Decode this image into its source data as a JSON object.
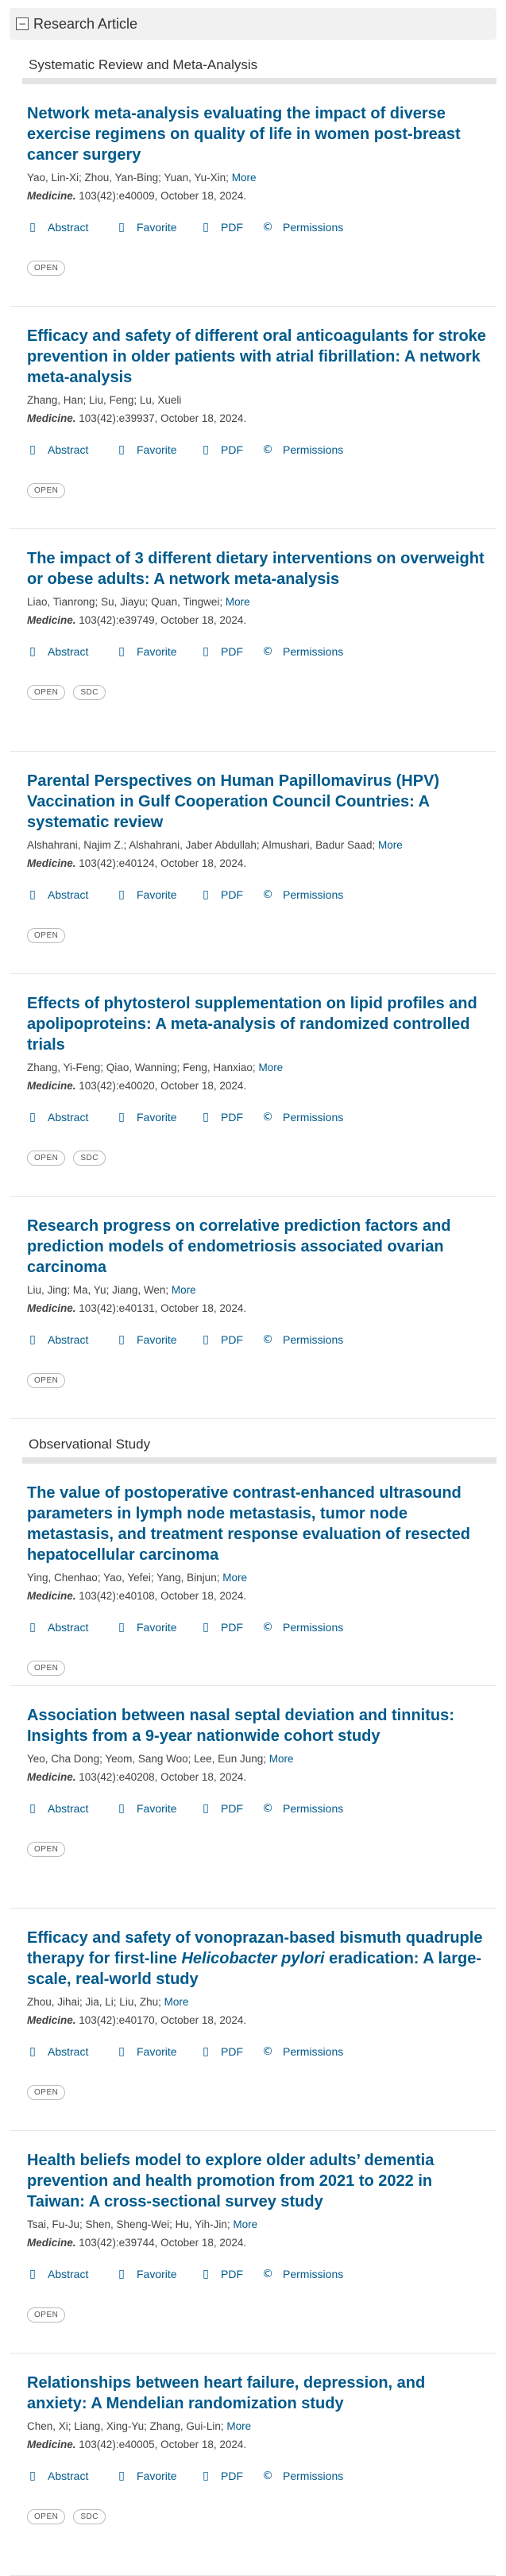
{
  "header": {
    "toggle_icon": "minus",
    "title": "Research Article"
  },
  "sections": [
    {
      "label": "Systematic Review and Meta-Analysis",
      "articles": [
        {
          "title": "Network meta-analysis evaluating the impact of diverse exercise regimens on quality of life in women post-breast cancer surgery",
          "authors": "Yao, Lin-Xi; Zhou, Yan-Bing; Yuan, Yu-Xin;",
          "more": "More",
          "journal": "Medicine.",
          "citation": "103(42):e40009, October 18, 2024.",
          "tags": [
            "OPEN"
          ]
        },
        {
          "title": "Efficacy and safety of different oral anticoagulants for stroke prevention in older patients with atrial fibrillation: A network meta-analysis",
          "authors": "Zhang, Han; Liu, Feng; Lu, Xueli",
          "more": "",
          "journal": "Medicine.",
          "citation": "103(42):e39937, October 18, 2024.",
          "tags": [
            "OPEN"
          ]
        },
        {
          "title": "The impact of 3 different dietary interventions on overweight or obese adults: A network meta-analysis",
          "authors": "Liao, Tianrong; Su, Jiayu; Quan, Tingwei;",
          "more": "More",
          "journal": "Medicine.",
          "citation": "103(42):e39749, October 18, 2024.",
          "tags": [
            "OPEN",
            "SDC"
          ]
        },
        {
          "title": "Parental Perspectives on Human Papillomavirus (HPV) Vaccination in Gulf Cooperation Council Countries: A systematic review",
          "authors": "Alshahrani, Najim Z.; Alshahrani, Jaber Abdullah; Almushari, Badur Saad;",
          "more": "More",
          "journal": "Medicine.",
          "citation": "103(42):e40124, October 18, 2024.",
          "tags": [
            "OPEN"
          ]
        },
        {
          "title": "Effects of phytosterol supplementation on lipid profiles and apolipoproteins: A meta-analysis of randomized controlled trials",
          "authors": "Zhang, Yi-Feng; Qiao, Wanning; Feng, Hanxiao;",
          "more": "More",
          "journal": "Medicine.",
          "citation": "103(42):e40020, October 18, 2024.",
          "tags": [
            "OPEN",
            "SDC"
          ]
        },
        {
          "title": "Research progress on correlative prediction factors and prediction models of endometriosis associated ovarian carcinoma",
          "authors": "Liu, Jing; Ma, Yu; Jiang, Wen;",
          "more": "More",
          "journal": "Medicine.",
          "citation": "103(42):e40131, October 18, 2024.",
          "tags": [
            "OPEN"
          ]
        }
      ]
    },
    {
      "label": "Observational Study",
      "articles": [
        {
          "title": "The value of postoperative contrast-enhanced ultrasound parameters in lymph node metastasis, tumor node metastasis, and treatment response evaluation of resected hepatocellular carcinoma",
          "authors": "Ying, Chenhao; Yao, Yefei; Yang, Binjun;",
          "more": "More",
          "journal": "Medicine.",
          "citation": "103(42):e40108, October 18, 2024.",
          "tags": [
            "OPEN"
          ]
        },
        {
          "title": "Association between nasal septal deviation and tinnitus: Insights from a 9-year nationwide cohort study",
          "authors": "Yeo, Cha Dong; Yeom, Sang Woo; Lee, Eun Jung;",
          "more": "More",
          "journal": "Medicine.",
          "citation": "103(42):e40208, October 18, 2024.",
          "tags": [
            "OPEN"
          ]
        },
        {
          "title_pre": "Efficacy and safety of vonoprazan-based bismuth quadruple therapy for first-line ",
          "title_italic": "Helicobacter pylori",
          "title_post": " eradication: A large-scale, real-world study",
          "authors": "Zhou, Jihai; Jia, Li; Liu, Zhu;",
          "more": "More",
          "journal": "Medicine.",
          "citation": "103(42):e40170, October 18, 2024.",
          "tags": [
            "OPEN"
          ]
        },
        {
          "title": "Health beliefs model to explore older adults’ dementia prevention and health promotion from 2021 to 2022 in Taiwan: A cross-sectional survey study",
          "authors": "Tsai, Fu-Ju; Shen, Sheng-Wei; Hu, Yih-Jin;",
          "more": "More",
          "journal": "Medicine.",
          "citation": "103(42):e39744, October 18, 2024.",
          "tags": [
            "OPEN"
          ]
        },
        {
          "title": "Relationships between heart failure, depression, and anxiety: A Mendelian randomization study",
          "authors": "Chen, Xi; Liang, Xing-Yu; Zhang, Gui-Lin;",
          "more": "More",
          "journal": "Medicine.",
          "citation": "103(42):e40005, October 18, 2024.",
          "tags": [
            "OPEN",
            "SDC"
          ]
        }
      ]
    }
  ],
  "actions": {
    "abstract": "Abstract",
    "favorite": "Favorite",
    "pdf": "PDF",
    "permissions": "Permissions",
    "abstract_icon": "document-icon",
    "favorite_icon": "bookmark-icon",
    "pdf_icon": "pdf-icon",
    "permissions_icon": "copyright-icon"
  },
  "colors": {
    "link": "#005a8c",
    "header_bg": "#f1f1f1",
    "rule": "#e4e4e4"
  }
}
